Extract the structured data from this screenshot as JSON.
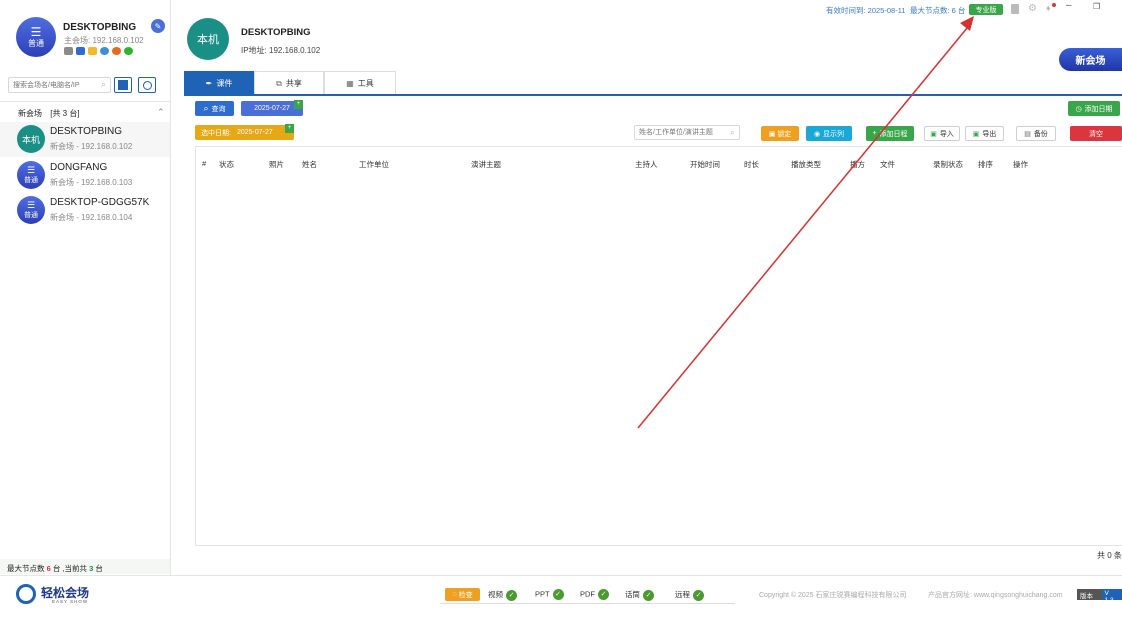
{
  "sidebar": {
    "host_name": "DESKTOPBING",
    "host_sub": "主会场: 192.168.0.102",
    "avatar_badge": "普通",
    "search_placeholder": "搜索会场名/电脑名/IP",
    "group_title": "新会场",
    "group_count": "[共 3 台]",
    "items": [
      {
        "name": "DESKTOPBING",
        "sub": "新会场 - 192.168.0.102",
        "badge": "本机",
        "style": "teal"
      },
      {
        "name": "DONGFANG",
        "sub": "新会场 - 192.168.0.103",
        "badge": "普通",
        "style": "blue"
      },
      {
        "name": "DESKTOP-GDGG57K",
        "sub": "新会场 - 192.168.0.104",
        "badge": "普通",
        "style": "blue"
      }
    ],
    "footer_prefix": "最大节点数",
    "footer_max": "6",
    "footer_mid": "台 ,当前共",
    "footer_current": "3",
    "footer_suffix": "台"
  },
  "header": {
    "avatar_label": "本机",
    "device_name": "DESKTOPBING",
    "ip_text": "IP地址: 192.168.0.102",
    "expire_text": "有效时间到: 2025-08-11",
    "max_nodes_text": "最大节点数: 6 台",
    "edition_badge": "专业版",
    "new_venue_button": "新会场"
  },
  "tabs": [
    {
      "label": "课件"
    },
    {
      "label": "共享"
    },
    {
      "label": "工具"
    }
  ],
  "toolbar": {
    "query_label": "查询",
    "date_value": "2025-07-27",
    "add_date_label": "添加日期",
    "selected_date_label": "选中日期:",
    "selected_date_value": "2025-07-27",
    "search_placeholder": "姓名/工作单位/演讲主题",
    "lock_label": "锁定",
    "show_columns_label": "显示列",
    "add_schedule_label": "添加日程",
    "import_label": "导入",
    "export_label": "导出",
    "backup_label": "备份",
    "clear_label": "清空"
  },
  "table": {
    "columns": [
      "#",
      "状态",
      "照片",
      "姓名",
      "工作单位",
      "演讲主题",
      "主持人",
      "开始时间",
      "时长",
      "播放类型",
      "播方",
      "文件",
      "录制状态",
      "排序",
      "操作"
    ],
    "total_text": "共 0 条"
  },
  "footer": {
    "logo_text": "轻松会场",
    "logo_sub": "EASY SHOW",
    "check_label": "检查",
    "status_items": [
      "视频",
      "PPT",
      "PDF",
      "话筒",
      "远程"
    ],
    "copyright": "Copyright © 2025 石家庄锐赛编程科技有限公司",
    "website": "产品官方网址: www.qingsonghuichang.com",
    "version_label": "版本号",
    "version_value": "V 1.3"
  },
  "colors": {
    "primary": "#1f63b6",
    "date_button": "#4a6fd8",
    "selected_date": "#e6a817",
    "lock": "#f0a020",
    "show_columns": "#1aa8d8",
    "add_schedule": "#3aa64a",
    "clear": "#d9363e",
    "add_date": "#3aa64a",
    "arrow": "#d93030"
  }
}
